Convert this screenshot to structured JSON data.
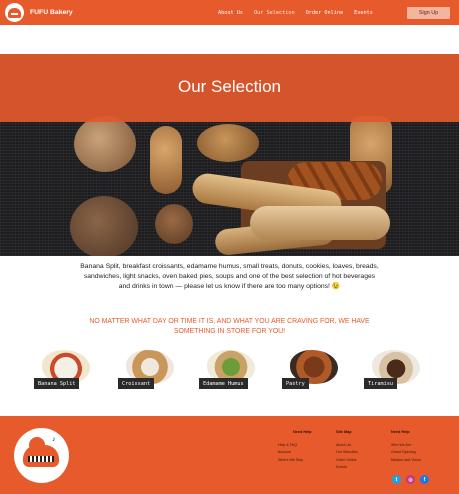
{
  "header": {
    "brand": "FUFU Bakery",
    "nav": [
      "About Us",
      "Our Selection",
      "Order Online",
      "Events"
    ],
    "active_nav": "Our Selection",
    "signup": "Sign Up"
  },
  "hero": {
    "title": "Our Selection"
  },
  "description": {
    "line1": "Banana Split, breakfast croissants, edamame humus, small treats, donuts, cookies, loaves, breads, sandwiches, light snacks, oven baked pies, soups and one of the best selection of hot beverages",
    "line2": "and drinks in town — please let us know if there are too many options! 😉"
  },
  "tagline": "NO MATTER WHAT DAY OR TIME IT IS, AND WHAT YOU ARE CRAVING FOR, WE HAVE SOMETHING IN STORE FOR YOU!",
  "products": [
    {
      "label": "Banana Split"
    },
    {
      "label": "Croissant"
    },
    {
      "label": "Edamame Humus"
    },
    {
      "label": "Pastry"
    },
    {
      "label": "Tiramisu"
    }
  ],
  "footer": {
    "col1": {
      "heading": "Need Help",
      "links": [
        "Help & FAQ",
        "Account",
        "Where We Ship"
      ]
    },
    "col2": {
      "heading": "Site Map",
      "links": [
        "About Us",
        "Our Selection",
        "Order Online",
        "Events"
      ]
    },
    "col3": {
      "heading": "Need Help",
      "links": [
        "Who We Are",
        "Grand Opening",
        "Mission and Vision"
      ]
    },
    "social": [
      "twitter-icon",
      "instagram-icon",
      "facebook-icon"
    ]
  },
  "colors": {
    "accent": "#e65a2c",
    "dark": "#1c1c1e"
  }
}
